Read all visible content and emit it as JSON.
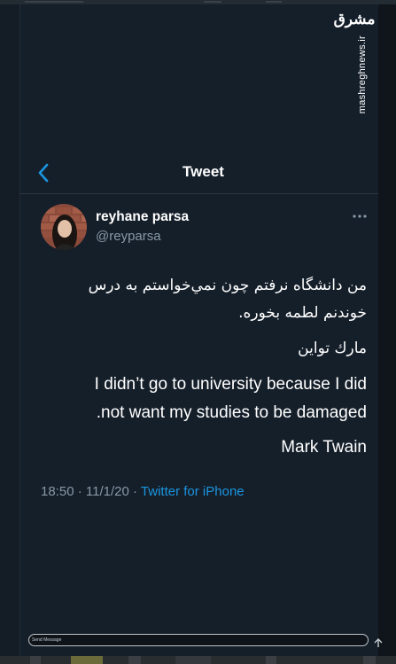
{
  "watermark": {
    "logo": "مشرق",
    "url": "mashreghnews.ir"
  },
  "header": {
    "title": "Tweet",
    "back_icon": "chevron-left-icon"
  },
  "tweet": {
    "author_name": "reyhane parsa",
    "author_handle": "@reyparsa",
    "text_fa_line1": "من دانشگاه نرفتم چون نمي‌خواستم به درس",
    "text_fa_line2": "خوندنم لطمه بخوره.",
    "text_fa_line3": "مارك تواين",
    "text_en_line1": "I didn’t go to university because I did",
    "text_en_line2": ".not want my studies to be damaged",
    "text_en_line3": "Mark Twain",
    "time": "18:50",
    "date": "11/1/20",
    "source": "Twitter for iPhone",
    "separator": "·"
  },
  "composer": {
    "placeholder": "Send Message"
  },
  "colors": {
    "background": "#151f2a",
    "accent": "#1b95e0",
    "secondary_text": "#8899a6",
    "primary_text": "#ffffff"
  }
}
